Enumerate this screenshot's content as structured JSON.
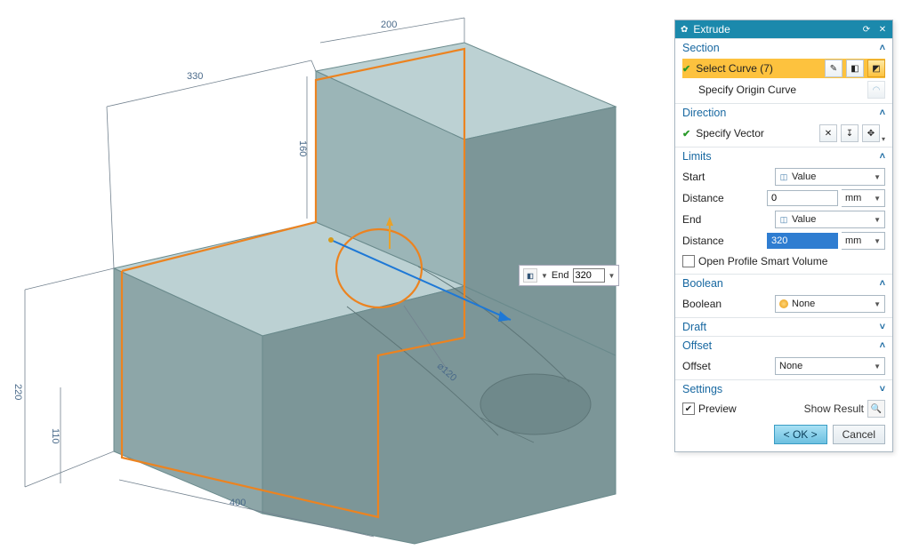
{
  "dialog": {
    "title": "Extrude",
    "sections": {
      "section": {
        "title": "Section",
        "select_curve_label": "Select Curve (7)",
        "specify_origin_label": "Specify Origin Curve"
      },
      "direction": {
        "title": "Direction",
        "specify_vector_label": "Specify Vector"
      },
      "limits": {
        "title": "Limits",
        "start_label": "Start",
        "start_type": "Value",
        "start_distance_label": "Distance",
        "start_distance_value": "0",
        "start_unit": "mm",
        "end_label": "End",
        "end_type": "Value",
        "end_distance_label": "Distance",
        "end_distance_value": "320",
        "end_unit": "mm",
        "open_profile_label": "Open Profile Smart Volume"
      },
      "boolean": {
        "title": "Boolean",
        "field_label": "Boolean",
        "value": "None"
      },
      "draft": {
        "title": "Draft"
      },
      "offset": {
        "title": "Offset",
        "field_label": "Offset",
        "value": "None"
      },
      "settings": {
        "title": "Settings",
        "preview_label": "Preview",
        "show_result_label": "Show Result"
      }
    },
    "ok_label": "< OK >",
    "cancel_label": "Cancel"
  },
  "viewport": {
    "dims": {
      "d1": "330",
      "d2": "200",
      "d3": "160",
      "d4": "220",
      "d5": "110",
      "d6": "400",
      "dia": "⌀120"
    },
    "on_canvas_end": {
      "label": "End",
      "value": "320"
    }
  },
  "colors": {
    "accent_header": "#1b89ac",
    "selection_hl": "#fdc23e",
    "profile_orange": "#ec8320",
    "vector_blue": "#1e78d6",
    "section_link": "#1868a1"
  }
}
